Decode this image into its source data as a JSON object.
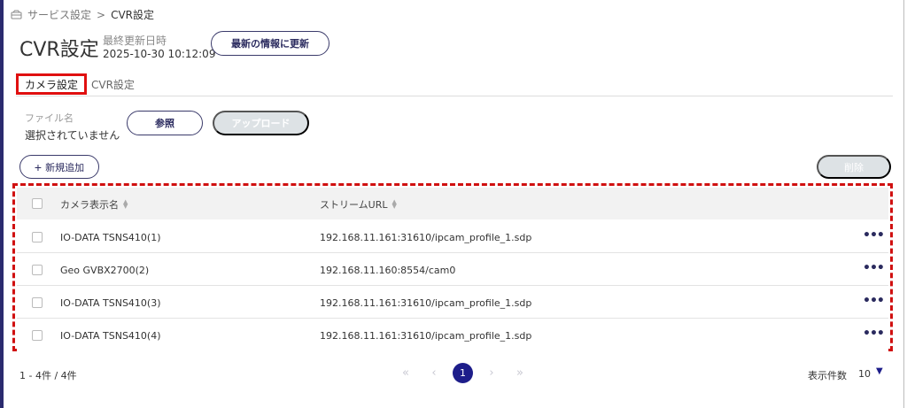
{
  "breadcrumb": {
    "parent": "サービス設定",
    "separator": ">",
    "current": "CVR設定"
  },
  "header": {
    "title": "CVR設定",
    "updated_label": "最終更新日時",
    "updated_value": "2025-10-30 10:12:09",
    "refresh_label": "最新の情報に更新"
  },
  "tabs": [
    {
      "label": "カメラ設定",
      "active": true
    },
    {
      "label": "CVR設定",
      "active": false
    }
  ],
  "file": {
    "label": "ファイル名",
    "value": "選択されていません",
    "browse_label": "参照",
    "upload_label": "アップロード"
  },
  "actions": {
    "add_label": "新規追加",
    "delete_label": "削除"
  },
  "table": {
    "columns": [
      "カメラ表示名",
      "ストリームURL"
    ],
    "rows": [
      {
        "name": "IO-DATA TSNS410(1)",
        "url": "192.168.11.161:31610/ipcam_profile_1.sdp"
      },
      {
        "name": "Geo GVBX2700(2)",
        "url": "192.168.11.160:8554/cam0"
      },
      {
        "name": "IO-DATA TSNS410(3)",
        "url": "192.168.11.161:31610/ipcam_profile_1.sdp"
      },
      {
        "name": "IO-DATA TSNS410(4)",
        "url": "192.168.11.161:31610/ipcam_profile_1.sdp"
      }
    ],
    "more_label": "•••"
  },
  "footer": {
    "count": "1 - 4件 / 4件",
    "current_page": "1",
    "per_page_label": "表示件数",
    "per_page_value": "10"
  },
  "colors": {
    "accent": "#1d1d8a",
    "highlight": "#e01010",
    "disabled": "#dde2e5"
  }
}
